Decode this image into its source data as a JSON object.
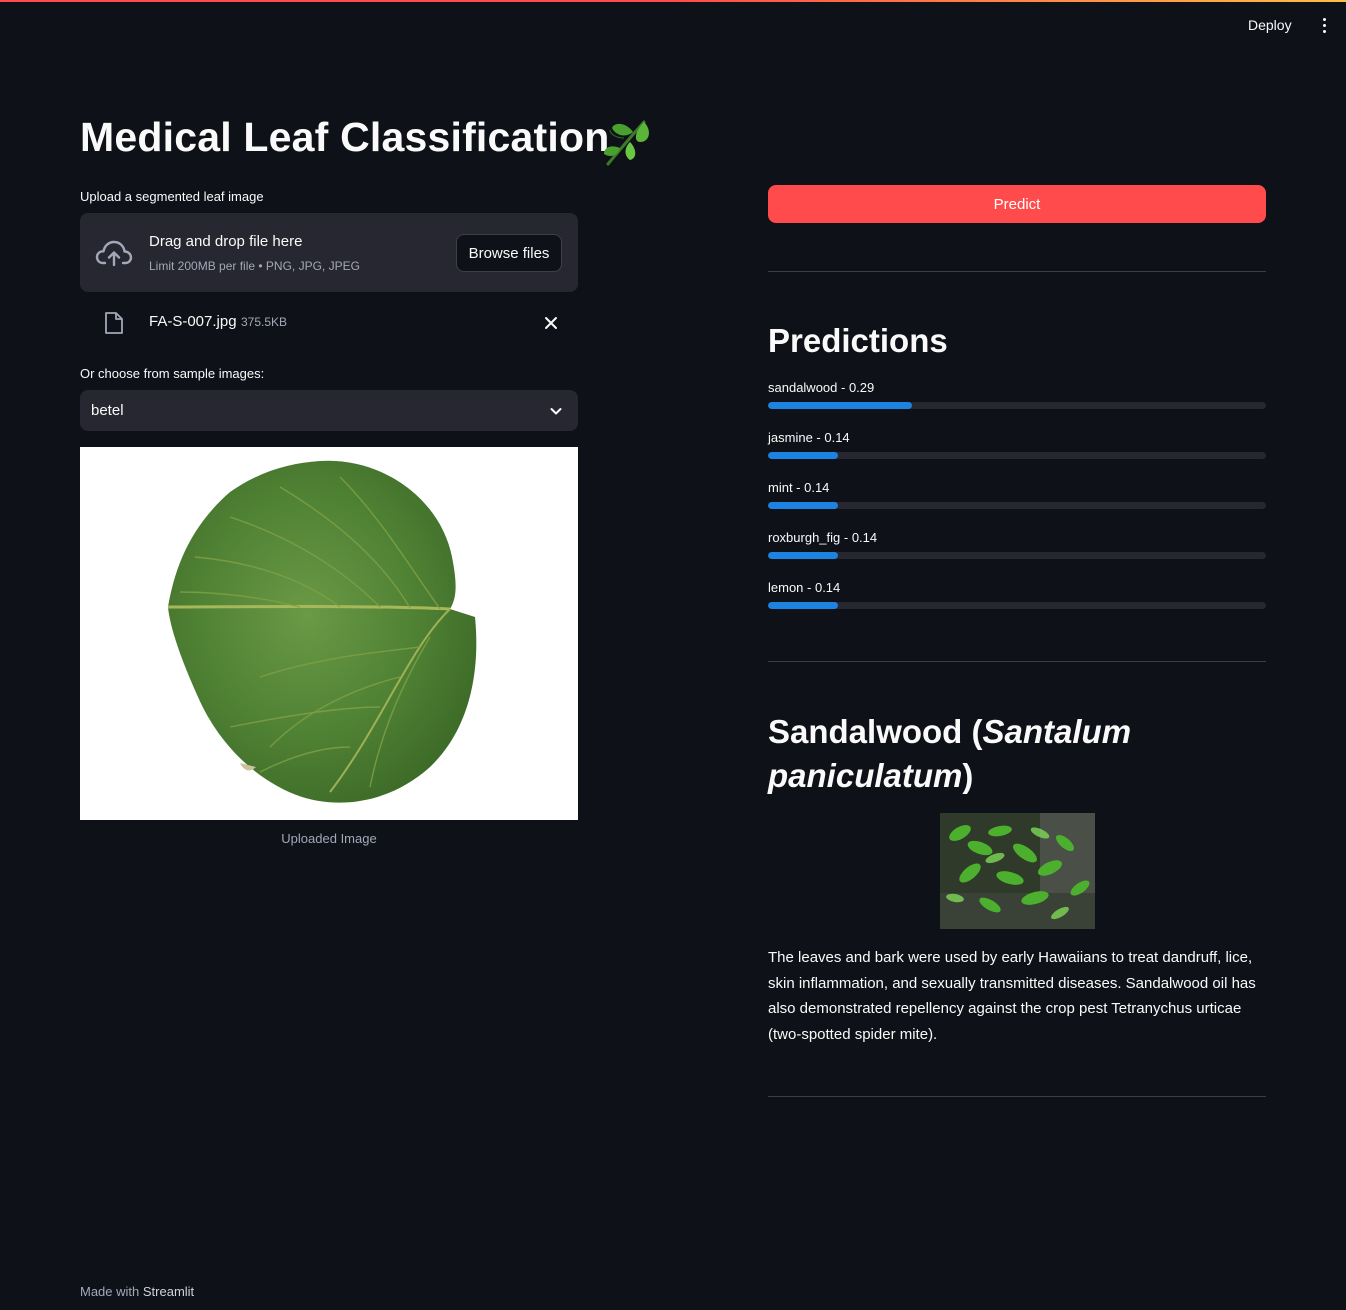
{
  "header": {
    "deploy_label": "Deploy",
    "menu_icon": "more-vertical-icon"
  },
  "page": {
    "title": "Medical Leaf Classification",
    "title_emoji": "herb-leaf-icon"
  },
  "uploader": {
    "label": "Upload a segmented leaf image",
    "drag_text": "Drag and drop file here",
    "limit_text": "Limit 200MB per file • PNG, JPG, JPEG",
    "browse_label": "Browse files",
    "icon": "cloud-upload-icon"
  },
  "uploaded_file": {
    "name": "FA-S-007.jpg",
    "size": "375.5KB",
    "icon": "file-icon",
    "remove_icon": "close-icon"
  },
  "sample_select": {
    "label": "Or choose from sample images:",
    "value": "betel",
    "icon": "chevron-down-icon"
  },
  "uploaded_image": {
    "caption": "Uploaded Image"
  },
  "predict_button": {
    "label": "Predict",
    "color": "#ff4b4b"
  },
  "predictions": {
    "title": "Predictions",
    "bar_color": "#1c83e1",
    "items": [
      {
        "label": "sandalwood - 0.29",
        "value": 0.29
      },
      {
        "label": "jasmine - 0.14",
        "value": 0.14
      },
      {
        "label": "mint - 0.14",
        "value": 0.14
      },
      {
        "label": "roxburgh_fig - 0.14",
        "value": 0.14
      },
      {
        "label": "lemon - 0.14",
        "value": 0.14
      }
    ]
  },
  "species": {
    "name": "Sandalwood",
    "scientific_name": "Santalum paniculatum",
    "description": "The leaves and bark were used by early Hawaiians to treat dandruff, lice, skin inflammation, and sexually transmitted diseases. Sandalwood oil has also demonstrated repellency against the crop pest Tetranychus urticae (two-spotted spider mite)."
  },
  "footer": {
    "prefix": "Made with",
    "brand": "Streamlit"
  }
}
